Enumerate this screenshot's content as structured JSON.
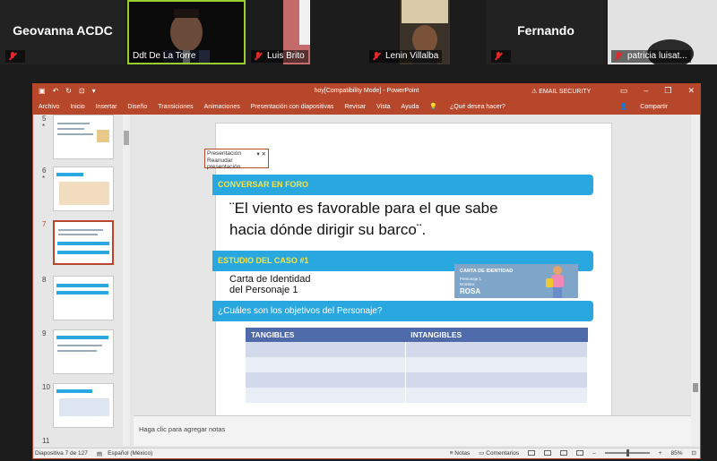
{
  "participants": [
    {
      "name": "Geovanna ACDC",
      "video": false
    },
    {
      "name": "Ddt De La Torre",
      "video": true,
      "active": true
    },
    {
      "name": "Luis Brito",
      "video": true
    },
    {
      "name": "Lenin Villalba",
      "video": true
    },
    {
      "name": "Fernando",
      "video": false
    },
    {
      "name": "patricia luisat...",
      "video": true
    }
  ],
  "powerpoint": {
    "title": "hoy[Compatibility Mode] - PowerPoint",
    "security_label": "EMAIL SECURITY",
    "menu": [
      "Archivo",
      "Inicio",
      "Insertar",
      "Diseño",
      "Transiciones",
      "Animaciones",
      "Presentación con diapositivas",
      "Revisar",
      "Vista",
      "Ayuda",
      "¿Qué desea hacer?"
    ],
    "share_label": "Compartir",
    "thumbnails": [
      {
        "num": "5",
        "star": "*"
      },
      {
        "num": "6",
        "star": "*"
      },
      {
        "num": "7",
        "star": ""
      },
      {
        "num": "8",
        "star": ""
      },
      {
        "num": "9",
        "star": ""
      },
      {
        "num": "10",
        "star": ""
      },
      {
        "num": "11",
        "star": ""
      }
    ],
    "tooltip": {
      "title": "Presentación",
      "action": "Reanudar presentación"
    },
    "slide": {
      "banner1": "CONVERSAR EN FORO",
      "quote": "¨El viento es favorable para el que sabe hacia dónde dirigir su barco¨.",
      "banner2": "ESTUDIO DEL CASO #1",
      "carta_line1": "Carta de Identidad",
      "carta_line2": "del Personaje 1",
      "card": {
        "heading": "CARTA DE IDENTIDAD",
        "sub1": "Personaje 1",
        "sub2": "Nombre:",
        "name": "ROSA"
      },
      "question": "¿Cuáles son los objetivos del Personaje?",
      "table_headers": [
        "TANGIBLES",
        "INTANGIBLES"
      ],
      "table_rows": 4
    },
    "notes_placeholder": "Haga clic para agregar notas",
    "status": {
      "slide_counter": "Diapositiva 7 de 127",
      "language": "Español (México)",
      "notes_btn": "Notas",
      "comments_btn": "Comentarios",
      "zoom": "85%"
    }
  }
}
